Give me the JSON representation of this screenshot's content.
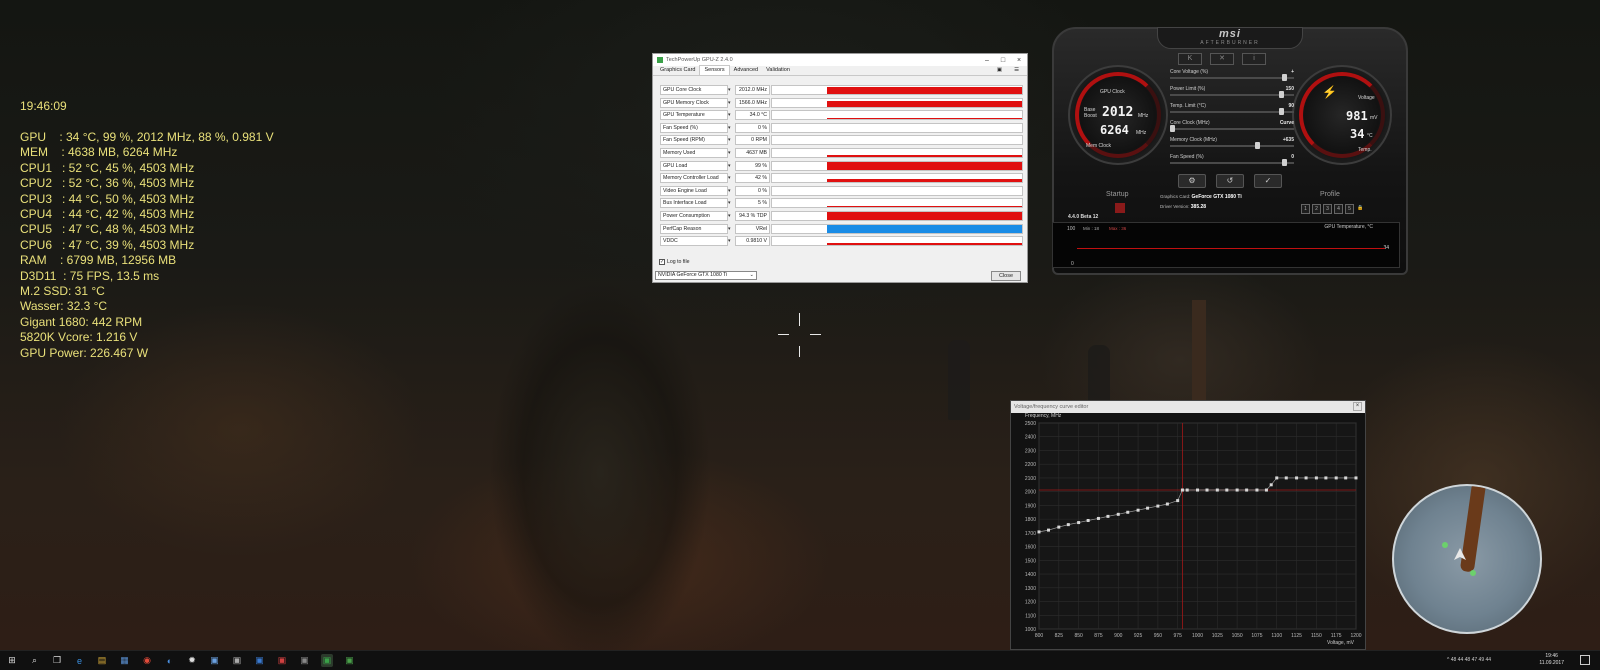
{
  "osd": {
    "time": "19:46:09",
    "lines": [
      "GPU    : 34 °C, 99 %, 2012 MHz, 88 %, 0.981 V",
      "MEM    : 4638 MB, 6264 MHz",
      "CPU1   : 52 °C, 45 %, 4503 MHz",
      "CPU2   : 52 °C, 36 %, 4503 MHz",
      "CPU3   : 44 °C, 50 %, 4503 MHz",
      "CPU4   : 44 °C, 42 %, 4503 MHz",
      "CPU5   : 47 °C, 48 %, 4503 MHz",
      "CPU6   : 47 °C, 39 %, 4503 MHz",
      "RAM    : 6799 MB, 12956 MB",
      "D3D11  : 75 FPS, 13.5 ms",
      "M.2 SSD: 31 °C",
      "Wasser: 32.3 °C",
      "Gigant 1680: 442 RPM",
      "5820K Vcore: 1.216 V",
      "GPU Power: 226.467 W"
    ]
  },
  "gpuz": {
    "title": "TechPowerUp GPU-Z 2.4.0",
    "tabs": [
      "Graphics Card",
      "Sensors",
      "Advanced",
      "Validation"
    ],
    "active_tab": "Sensors",
    "sensors": [
      {
        "name": "GPU Core Clock",
        "value": "2012.0 MHz",
        "level": 0.9,
        "color": "#e01010"
      },
      {
        "name": "GPU Memory Clock",
        "value": "1566.0 MHz",
        "level": 0.7,
        "color": "#e01010"
      },
      {
        "name": "GPU Temperature",
        "value": "34.0 °C",
        "level": 0.2,
        "color": "#e01010"
      },
      {
        "name": "Fan Speed (%)",
        "value": "0 %",
        "level": 0,
        "color": "#e01010"
      },
      {
        "name": "Fan Speed (RPM)",
        "value": "0 RPM",
        "level": 0,
        "color": "#e01010"
      },
      {
        "name": "Memory Used",
        "value": "4637 MB",
        "level": 0.3,
        "color": "#e01010"
      },
      {
        "name": "GPU Load",
        "value": "99 %",
        "level": 0.99,
        "color": "#e01010"
      },
      {
        "name": "Memory Controller Load",
        "value": "42 %",
        "level": 0.42,
        "color": "#e01010"
      },
      {
        "name": "Video Engine Load",
        "value": "0 %",
        "level": 0,
        "color": "#e01010"
      },
      {
        "name": "Bus Interface Load",
        "value": "5 %",
        "level": 0.05,
        "color": "#e01010"
      },
      {
        "name": "Power Consumption",
        "value": "94.3 % TDP",
        "level": 0.94,
        "color": "#e01010"
      },
      {
        "name": "PerfCap Reason",
        "value": "VRel",
        "level": 1,
        "color": "#1a8ce6"
      },
      {
        "name": "VDDC",
        "value": "0.9810 V",
        "level": 0.25,
        "color": "#e01010"
      }
    ],
    "log_to_file": "Log to file",
    "gpu_select": "NVIDIA GeForce GTX 1080 Ti",
    "close_label": "Close"
  },
  "afterburner": {
    "brand": "msi",
    "product": "AFTERBURNER",
    "left_gauge": {
      "label": "GPU Clock",
      "base_label": "Base",
      "boost_label": "Boost",
      "core_value": "2012",
      "core_unit": "MHz",
      "mem_value": "6264",
      "mem_unit": "MHz",
      "mem_label": "Mem Clock"
    },
    "right_gauge": {
      "label": "Voltage",
      "volt_value": "981",
      "volt_unit": "mV",
      "temp_value": "34",
      "temp_unit": "°C",
      "temp_label": "Temp."
    },
    "sliders": [
      {
        "label": "Core Voltage (%)",
        "value": "+",
        "level": 0.95
      },
      {
        "label": "Power Limit (%)",
        "value": "150",
        "level": 0.92
      },
      {
        "label": "Temp. Limit (°C)",
        "value": "90",
        "level": 0.92
      },
      {
        "label": "Core Clock (MHz)",
        "value": "Curve",
        "level": 0.0
      },
      {
        "label": "Memory Clock (MHz)",
        "value": "+635",
        "level": 0.72
      },
      {
        "label": "Fan Speed (%)",
        "value": "0",
        "level": 0.95
      }
    ],
    "startup_label": "Startup",
    "profile_label": "Profile",
    "profile_slots": [
      "1",
      "2",
      "3",
      "4",
      "5"
    ],
    "graphics_card_label": "Graphics Card:",
    "graphics_card_value": "GeForce GTX 1080 Ti",
    "driver_label": "Driver Version:",
    "driver_value": "385.28",
    "version": "4.4.0 Beta 12",
    "monitor": {
      "title": "GPU Temperature, °C",
      "min_label": "Min : 18",
      "max_label": "Max : 36",
      "y_top": "100",
      "y_bottom": "0",
      "current": "34"
    }
  },
  "vf_editor": {
    "title": "Voltage/frequency curve editor",
    "y_title": "Frequency, MHz",
    "x_title": "Voltage, mV",
    "y_ticks": [
      "2500",
      "2400",
      "2300",
      "2200",
      "2100",
      "2000",
      "1900",
      "1800",
      "1700",
      "1600",
      "1500",
      "1400",
      "1300",
      "1200",
      "1100",
      "1000"
    ],
    "x_ticks": [
      "800",
      "825",
      "850",
      "875",
      "900",
      "925",
      "950",
      "975",
      "1000",
      "1025",
      "1050",
      "1075",
      "1100",
      "1125",
      "1150",
      "1175",
      "1200"
    ],
    "selected_voltage": 981,
    "selected_freq": 2012,
    "curve_points": [
      [
        800,
        1707
      ],
      [
        812,
        1720
      ],
      [
        825,
        1742
      ],
      [
        837,
        1760
      ],
      [
        850,
        1775
      ],
      [
        862,
        1790
      ],
      [
        875,
        1805
      ],
      [
        887,
        1820
      ],
      [
        900,
        1835
      ],
      [
        912,
        1850
      ],
      [
        925,
        1865
      ],
      [
        937,
        1880
      ],
      [
        950,
        1895
      ],
      [
        962,
        1910
      ],
      [
        975,
        1935
      ],
      [
        981,
        2012
      ],
      [
        987,
        2012
      ],
      [
        1000,
        2012
      ],
      [
        1012,
        2012
      ],
      [
        1025,
        2012
      ],
      [
        1037,
        2012
      ],
      [
        1050,
        2012
      ],
      [
        1062,
        2012
      ],
      [
        1075,
        2012
      ],
      [
        1087,
        2012
      ],
      [
        1093,
        2050
      ],
      [
        1100,
        2100
      ],
      [
        1112,
        2100
      ],
      [
        1125,
        2100
      ],
      [
        1137,
        2100
      ],
      [
        1150,
        2100
      ],
      [
        1162,
        2100
      ],
      [
        1175,
        2100
      ],
      [
        1187,
        2100
      ],
      [
        1200,
        2100
      ]
    ]
  },
  "taskbar": {
    "icons": [
      "start-icon",
      "search-icon",
      "task-view-icon",
      "edge-icon",
      "explorer-icon",
      "store-icon",
      "chrome-icon",
      "app-icon",
      "settings-icon",
      "app-icon",
      "app-icon",
      "app-icon",
      "app-icon",
      "app-icon",
      "gpuz-taskbar-icon",
      "afterburner-taskbar-icon"
    ],
    "tray_temps": "^ 48 44 48 47 49 44",
    "time": "19:46",
    "date": "11.09.2017"
  }
}
